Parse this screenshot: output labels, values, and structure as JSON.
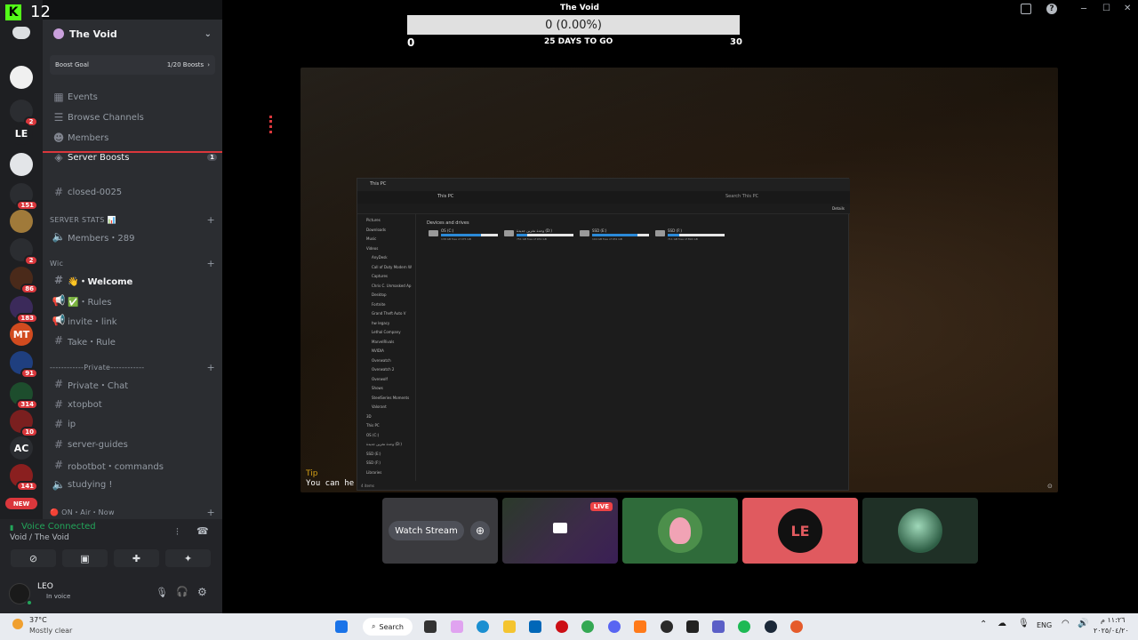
{
  "overlay": {
    "badge_number": "12"
  },
  "goal": {
    "window_title": "The Void",
    "bar_text": "0 (0.00%)",
    "start": "0",
    "end": "30",
    "days_to_go": "25 DAYS TO GO",
    "progress": 0
  },
  "rail": {
    "servers": [
      {
        "label": "",
        "badge": ""
      },
      {
        "label": "",
        "badge": "2"
      },
      {
        "label": "LE",
        "badge": ""
      },
      {
        "label": "",
        "badge": ""
      },
      {
        "label": "",
        "badge": "151"
      },
      {
        "label": "",
        "badge": ""
      },
      {
        "label": "",
        "badge": "2"
      },
      {
        "label": "",
        "badge": "86"
      },
      {
        "label": "",
        "badge": "183"
      },
      {
        "label": "MT",
        "badge": ""
      },
      {
        "label": "",
        "badge": "91"
      },
      {
        "label": "",
        "badge": "314"
      },
      {
        "label": "",
        "badge": "10"
      },
      {
        "label": "AC",
        "badge": ""
      },
      {
        "label": "",
        "badge": "141"
      }
    ],
    "new_pill": "NEW"
  },
  "sidebar": {
    "guild_name": "The Void",
    "boost_goal_label": "Boost Goal",
    "boost_goal_value": "1/20 Boosts",
    "events": "Events",
    "browse_channels": "Browse Channels",
    "members": "Members",
    "server_boosts": "Server Boosts",
    "server_boosts_count": "1",
    "closed_channel": "closed-0025",
    "cat_server_stats": "SERVER STATS 📊",
    "members_count": "Members・289",
    "cat_wic": "Wic",
    "welcome": "👋・Welcome",
    "rules": "✅・Rules",
    "invite_link": "invite・link",
    "take_rule": "Take・Rule",
    "cat_private": "------------Private------------",
    "private_chat": "Private・Chat",
    "xtopbot": "xtopbot",
    "ip": "ip",
    "server_guides": "server-guides",
    "robotbot_commands": "robotbot・commands",
    "studying": "studying !",
    "cat_on_air": "🔴 ON・Air・Now"
  },
  "voice": {
    "status": "Voice Connected",
    "location": "Void / The Void"
  },
  "user": {
    "name": "LEO",
    "status": "In voice"
  },
  "stream": {
    "tip_label": "Tip",
    "tip_text": "You can he",
    "explorer": {
      "title": "This PC",
      "path": "This PC",
      "search": "Search This PC",
      "section": "Devices and drives",
      "details": "Details",
      "drives": [
        {
          "name": "OS (C:)",
          "free": "138 GB free of 475 GB",
          "used": 0.71
        },
        {
          "name": "وحدة تخزين جديدة (D:)",
          "free": "751 GB free of 931 GB",
          "used": 0.19
        },
        {
          "name": "SSD (E:)",
          "free": "194 GB free of 931 GB",
          "used": 0.79
        },
        {
          "name": "SSD (F:)",
          "free": "711 GB free of 894 GB",
          "used": 0.2
        }
      ],
      "nav": [
        "Pictures",
        "Downloads",
        "Music",
        "Videos",
        "AnyDesk",
        "Call of Duty  Modern W",
        "Captures",
        "Chris C. Unmasked Ap",
        "Desktop",
        "Fortnite",
        "Grand Theft Auto V",
        "hw legacy",
        "Lethal Company",
        "MarvelRivals",
        "NVIDIA",
        "Overwatch",
        "Overwatch 2",
        "Overwolf",
        "Shows",
        "SteelSeries Moments",
        "Valorant",
        "3D",
        "This PC",
        "OS (C:)",
        "وحدة تخزين جديدة (D:)",
        "SSD (E:)",
        "SSD (F:)",
        "Libraries"
      ],
      "status": "4 items"
    }
  },
  "tiles": {
    "watch_stream": "Watch Stream",
    "live": "LIVE"
  },
  "taskbar": {
    "weather_temp": "37°C",
    "weather_desc": "Mostly clear",
    "search": "Search",
    "lang": "ENG",
    "time": "١١:٢٦ م",
    "date": "٢٠٢٥/٠٤/٢٠"
  },
  "colors": {
    "accent_green": "#23a55a",
    "badge_red": "#da373c",
    "live_red": "#ed4245",
    "le_tile": "#e05a5f"
  }
}
